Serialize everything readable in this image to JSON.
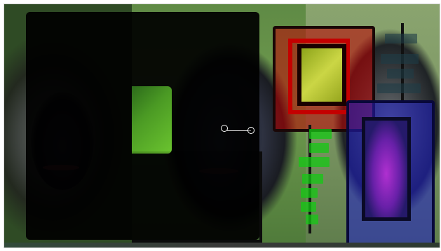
{
  "image": {
    "description": ""
  },
  "overlays": {
    "red_panel_color": "#c00000",
    "blue_panel_color": "#2a2ad0",
    "green_bar_color": "#14c814",
    "handle_color": "#ffffff"
  }
}
